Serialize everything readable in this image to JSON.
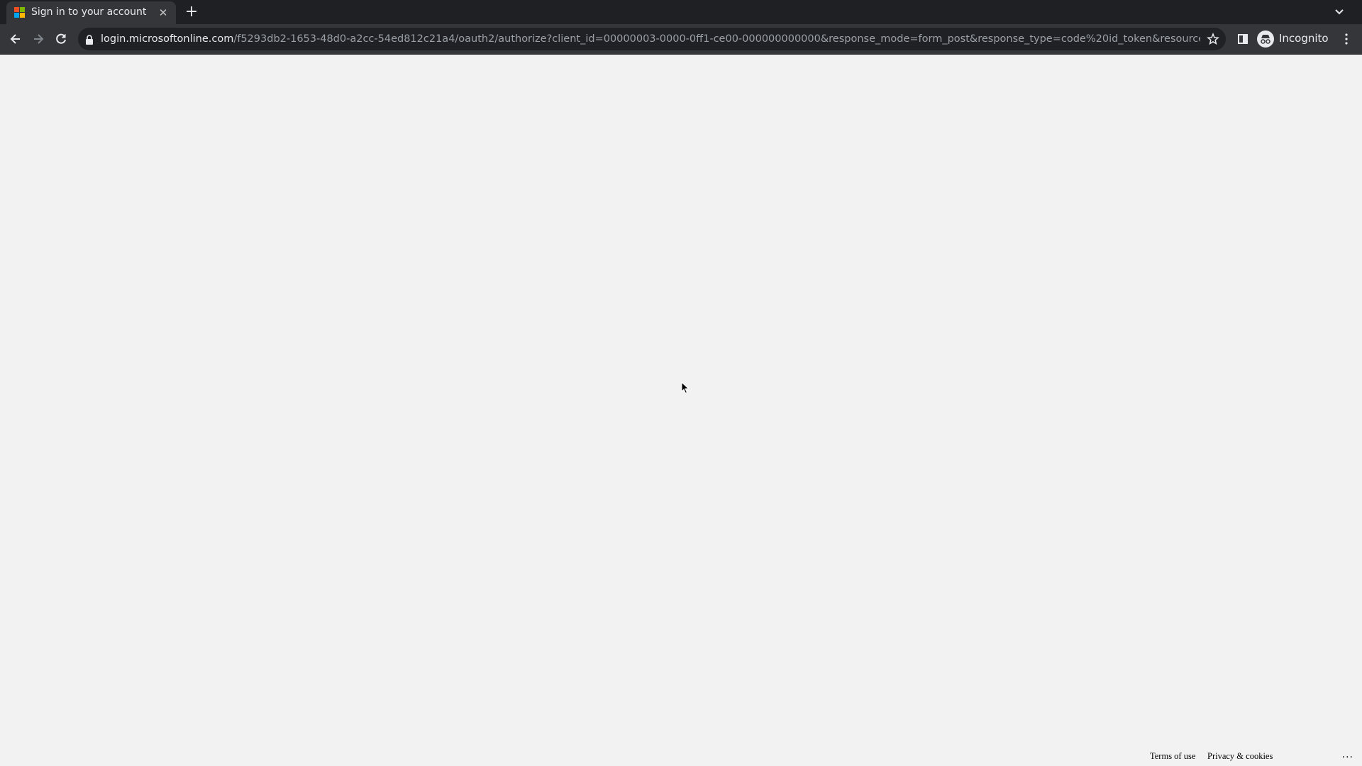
{
  "browser": {
    "tab": {
      "title": "Sign in to your account",
      "favicon": "microsoft-logo",
      "close_glyph": "✕"
    },
    "new_tab_glyph": "+",
    "toolbar": {
      "url_host": "login.microsoftonline.com",
      "url_path": "/f5293db2-1653-48d0-a2cc-54ed812c21a4/oauth2/authorize?client_id=00000003-0000-0ff1-ce00-000000000000&response_mode=form_post&response_type=code%20id_token&resource=...",
      "incognito_label": "Incognito"
    },
    "colors": {
      "tab_strip": "#1f2023",
      "toolbar": "#35363a",
      "omnibox": "#202124",
      "page_background": "#f2f2f2"
    }
  },
  "page": {
    "footer": {
      "terms_label": "Terms of use",
      "privacy_label": "Privacy & cookies",
      "more_label": "..."
    }
  }
}
